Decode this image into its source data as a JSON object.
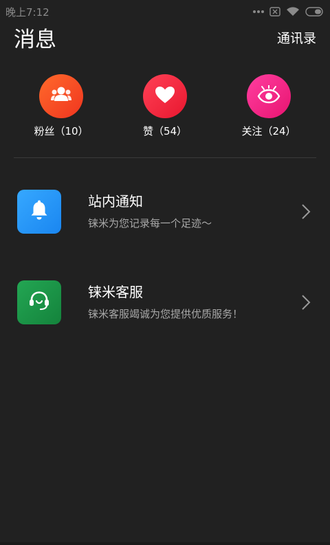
{
  "status_bar": {
    "time": "晚上7:12",
    "icons": [
      "more-dots-icon",
      "sim-off-icon",
      "wifi-icon",
      "battery-icon"
    ]
  },
  "header": {
    "title": "消息",
    "contacts_label": "通讯录"
  },
  "stats": [
    {
      "name": "fans",
      "label": "粉丝（10）",
      "icon": "users-icon",
      "color": "#f6492a"
    },
    {
      "name": "likes",
      "label": "赞（54）",
      "icon": "heart-icon",
      "color": "#f5263f"
    },
    {
      "name": "follow",
      "label": "关注（24）",
      "icon": "eye-icon",
      "color": "#f42689"
    }
  ],
  "list": [
    {
      "name": "notice",
      "title": "站内通知",
      "subtitle": "铼米为您记录每一个足迹～",
      "icon": "bell-icon",
      "color": "#2895fa"
    },
    {
      "name": "service",
      "title": "铼米客服",
      "subtitle": "铼米客服竭诚为您提供优质服务！",
      "icon": "headset-icon",
      "color": "#1c9447"
    }
  ],
  "colors": {
    "background": "#212121",
    "text_primary": "#ffffff",
    "text_secondary": "#a8a8a8",
    "divider": "#3a3a3a"
  }
}
